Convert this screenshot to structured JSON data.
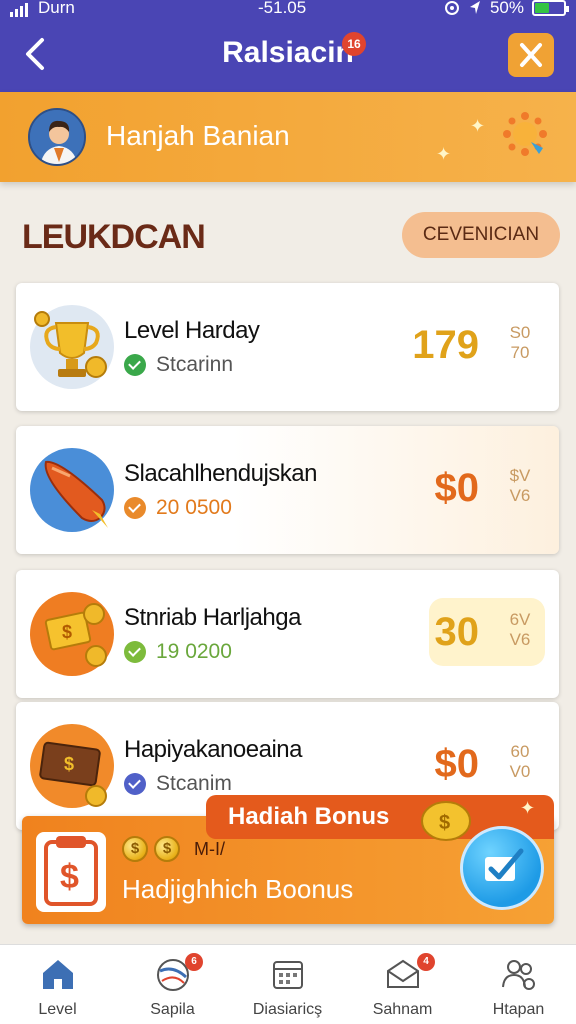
{
  "status_bar": {
    "carrier": "Durn",
    "time": "-51.05",
    "battery": "50%",
    "battery_level": 0.5
  },
  "header": {
    "title": "Ralsiacin",
    "badge": "16"
  },
  "profile": {
    "name": "Hanjah Banian"
  },
  "section": {
    "title": "LEUKDCAN",
    "button": "CEVENICIAN"
  },
  "cards": [
    {
      "title": "Level Harday",
      "subtitle": "Stcarinn",
      "value": "179",
      "frac_top": "S0",
      "frac_bottom": "70",
      "value_color": "#e0a21a",
      "status_color": "#3aa84a"
    },
    {
      "title": "Slacahlhendujskan",
      "subtitle": "20 0500",
      "value": "$0",
      "frac_top": "$V",
      "frac_bottom": "V6",
      "value_color": "#e2691c",
      "status_color": "#e98a2b"
    },
    {
      "title": "Stnriab Harljahga",
      "subtitle": "19 0200",
      "value": "30",
      "frac_top": "6V",
      "frac_bottom": "V6",
      "value_color": "#e0a21a",
      "status_color": "#7dbb3c"
    },
    {
      "title": "Hapiyakanoeaina",
      "subtitle": "Stcanim",
      "value": "$0",
      "frac_top": "60",
      "frac_bottom": "V0",
      "value_color": "#e2691c",
      "status_color": "#5060c8"
    }
  ],
  "bonus": {
    "tag": "Hadiah Bonus",
    "code": "M-I/",
    "text": "Hadjighhich Boonus",
    "coin_symbol": "$"
  },
  "tabs": [
    {
      "label": "Level",
      "badge": ""
    },
    {
      "label": "Sapila",
      "badge": "6"
    },
    {
      "label": "Diasiaricş",
      "badge": ""
    },
    {
      "label": "Sahnam",
      "badge": "4"
    },
    {
      "label": "Htapan",
      "badge": ""
    }
  ]
}
